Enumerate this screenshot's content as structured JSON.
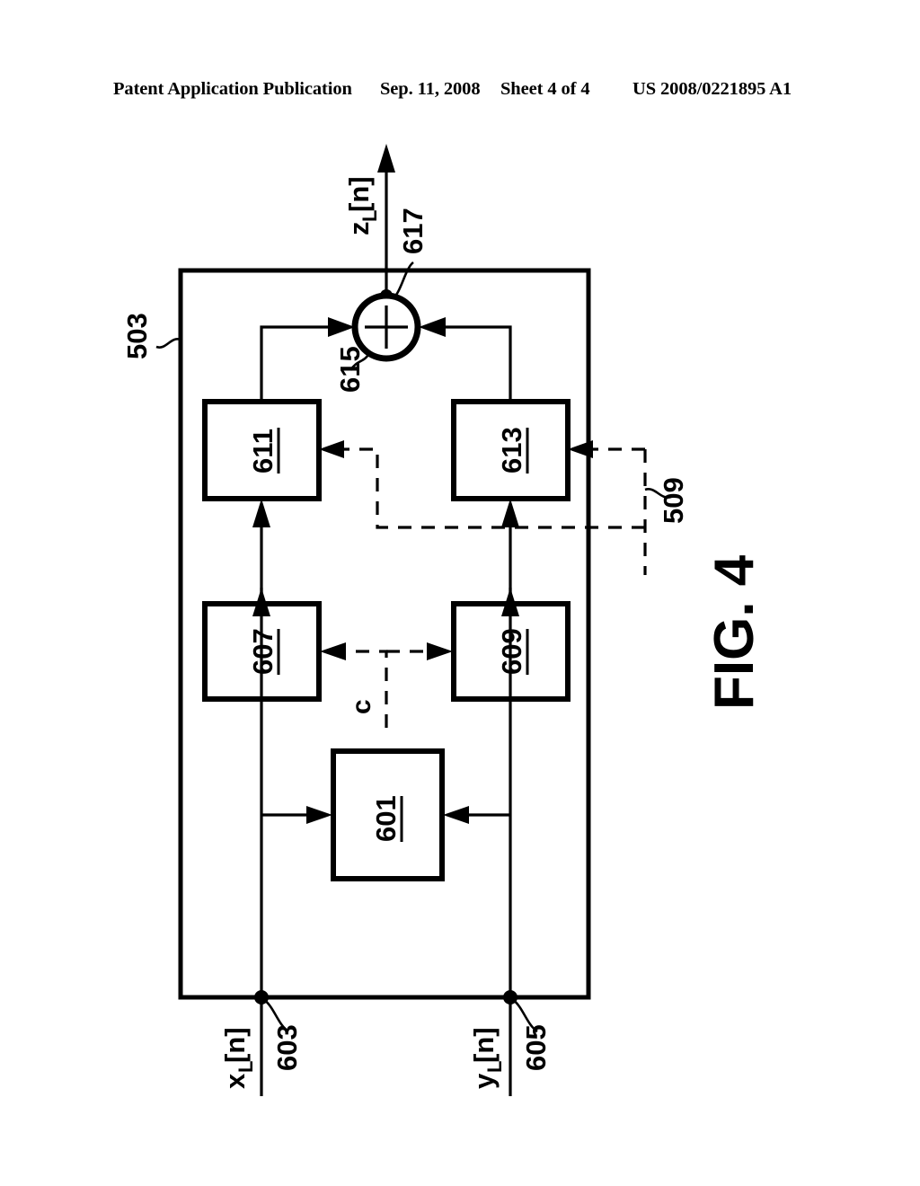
{
  "header": {
    "publication": "Patent Application Publication",
    "date": "Sep. 11, 2008",
    "sheet": "Sheet 4 of 4",
    "patent_number": "US 2008/0221895 A1"
  },
  "figure": {
    "title": "FIG. 4",
    "outer_block_ref": "503",
    "blocks": [
      {
        "ref": "601"
      },
      {
        "ref": "607"
      },
      {
        "ref": "609"
      },
      {
        "ref": "611"
      },
      {
        "ref": "613"
      }
    ],
    "signals": {
      "input_left_label": "x",
      "input_left_sub": "L",
      "input_left_index": "[n]",
      "input_left_ref": "603",
      "input_right_label": "y",
      "input_right_sub": "L",
      "input_right_index": "[n]",
      "input_right_ref": "605",
      "output_label": "z",
      "output_sub": "L",
      "output_index": "[n]",
      "output_ref": "617",
      "adder_ref": "615",
      "control_label": "c",
      "coef_bus_ref": "509"
    }
  }
}
